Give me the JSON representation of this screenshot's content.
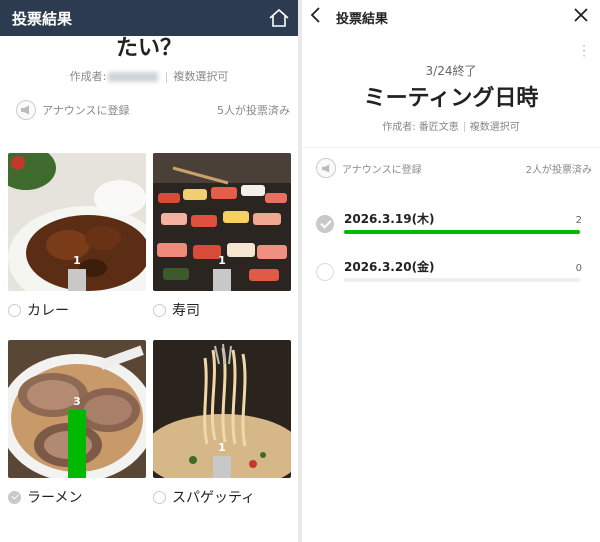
{
  "left": {
    "header_title": "投票結果",
    "question": "たい？",
    "author_label": "作成者:",
    "multi": "複数選択可",
    "announce": "アナウンスに登録",
    "voted": "5人が投票済み",
    "options": [
      {
        "label": "カレー",
        "count": "1",
        "fraction": 0.33,
        "selected": false
      },
      {
        "label": "寿司",
        "count": "1",
        "fraction": 0.33,
        "selected": false
      },
      {
        "label": "ラーメン",
        "count": "3",
        "fraction": 1.0,
        "selected": true
      },
      {
        "label": "スパゲッティ",
        "count": "1",
        "fraction": 0.33,
        "selected": false
      }
    ]
  },
  "right": {
    "header_title": "投票結果",
    "end_date": "3/24終了",
    "question": "ミーティング日時",
    "author": "作成者: 番匠文恵",
    "multi": "複数選択可",
    "announce": "アナウンスに登録",
    "voted": "2人が投票済み",
    "options": [
      {
        "label": "2026.3.19(木)",
        "count": "2",
        "fraction": 1.0,
        "selected": true
      },
      {
        "label": "2026.3.20(金)",
        "count": "0",
        "fraction": 0.0,
        "selected": false
      }
    ]
  },
  "icons": {
    "home": "home-icon",
    "back": "back-icon",
    "close": "close-icon",
    "megaphone": "megaphone-icon",
    "more": "more-vertical-icon"
  },
  "colors": {
    "header_bg": "#2d3b50",
    "accent": "#00b900",
    "neutral_bar": "#c8c8c8"
  }
}
